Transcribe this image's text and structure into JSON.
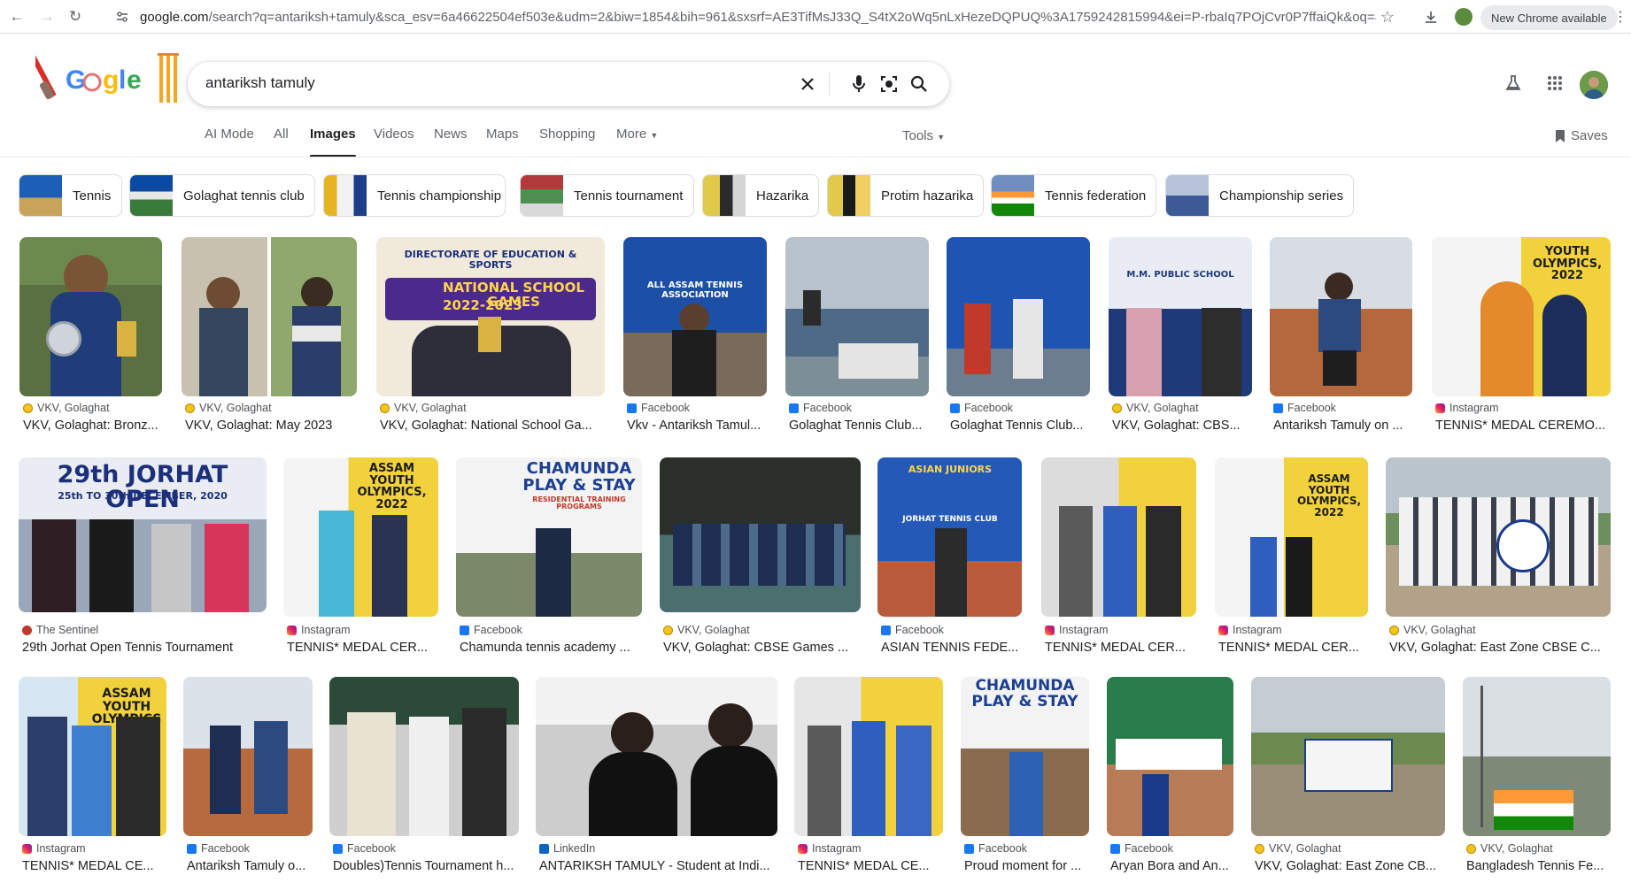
{
  "browser": {
    "url_host": "google.com",
    "url_path": "/search?q=antariksh+tamuly&sca_esv=6a46622504ef503e&udm=2&biw=1854&bih=961&sxsrf=AE3TifMsJ33Q_S4tX2oWq5nLxHezeDQPUQ%3A1759242815994&ei=P-rbaIq7POjCvr0P7ffaiQk&oq=antarIKSH+T...",
    "new_chrome_label": "New Chrome available"
  },
  "search": {
    "query": "antariksh tamuly"
  },
  "tabs": [
    {
      "label": "AI Mode"
    },
    {
      "label": "All"
    },
    {
      "label": "Images"
    },
    {
      "label": "Videos"
    },
    {
      "label": "News"
    },
    {
      "label": "Maps"
    },
    {
      "label": "Shopping"
    },
    {
      "label": "More"
    }
  ],
  "tools_label": "Tools",
  "saves_label": "Saves",
  "chips": [
    {
      "label": "Tennis"
    },
    {
      "label": "Golaghat tennis club"
    },
    {
      "label": "Tennis championship"
    },
    {
      "label": "Tennis tournament"
    },
    {
      "label": "Hazarika"
    },
    {
      "label": "Protim hazarika"
    },
    {
      "label": "Tennis federation"
    },
    {
      "label": "Championship series"
    }
  ],
  "results": [
    {
      "source": "VKV, Golaghat",
      "title": "VKV, Golaghat: Bronz..."
    },
    {
      "source": "VKV, Golaghat",
      "title": "VKV, Golaghat: May 2023"
    },
    {
      "source": "VKV, Golaghat",
      "title": "VKV, Golaghat: National School Ga..."
    },
    {
      "source": "Facebook",
      "title": "Vkv - Antariksh Tamul..."
    },
    {
      "source": "Facebook",
      "title": "Golaghat Tennis Club..."
    },
    {
      "source": "Facebook",
      "title": "Golaghat Tennis Club..."
    },
    {
      "source": "VKV, Golaghat",
      "title": "VKV, Golaghat: CBS..."
    },
    {
      "source": "Facebook",
      "title": "Antariksh Tamuly on ..."
    },
    {
      "source": "Instagram",
      "title": "TENNIS* MEDAL CEREMO..."
    },
    {
      "source": "The Sentinel",
      "title": "29th Jorhat Open Tennis Tournament"
    },
    {
      "source": "Instagram",
      "title": "TENNIS* MEDAL CER..."
    },
    {
      "source": "Facebook",
      "title": "Chamunda tennis academy ..."
    },
    {
      "source": "VKV, Golaghat",
      "title": "VKV, Golaghat: CBSE Games ..."
    },
    {
      "source": "Facebook",
      "title": "ASIAN TENNIS FEDE..."
    },
    {
      "source": "Instagram",
      "title": "TENNIS* MEDAL CER..."
    },
    {
      "source": "Instagram",
      "title": "TENNIS* MEDAL CER..."
    },
    {
      "source": "VKV, Golaghat",
      "title": "VKV, Golaghat: East Zone CBSE C..."
    },
    {
      "source": "Instagram",
      "title": "TENNIS* MEDAL CE..."
    },
    {
      "source": "Facebook",
      "title": "Antariksh Tamuly o..."
    },
    {
      "source": "Facebook",
      "title": "Doubles)Tennis Tournament h..."
    },
    {
      "source": "LinkedIn",
      "title": "ANTARIKSH TAMULY - Student at Indi..."
    },
    {
      "source": "Instagram",
      "title": "TENNIS* MEDAL CE..."
    },
    {
      "source": "Facebook",
      "title": "Proud moment for ..."
    },
    {
      "source": "Facebook",
      "title": "Aryan Bora and An..."
    },
    {
      "source": "VKV, Golaghat",
      "title": "VKV, Golaghat: East Zone CB..."
    },
    {
      "source": "VKV, Golaghat",
      "title": "Bangladesh Tennis Fe..."
    }
  ],
  "image_text": {
    "r2": "DIRECTORATE OF EDUCATION & SPORTS",
    "r2b": "NATIONAL SCHOOL GAMES",
    "r2c": "2022-2023",
    "r9": "YOUTH OLYMPICS, 2022",
    "r10": "29th JORHAT OPEN",
    "r10b": "25th TO 30th DECEMBER, 2020",
    "r11": "ASSAM YOUTH OLYMPICS, 2022",
    "r12": "CHAMUNDA PLAY & STAY",
    "r12b": "RESIDENTIAL TRAINING PROGRAMS",
    "r14": "ASIAN JUNIORS",
    "r14b": "JORHAT TENNIS CLUB",
    "r16": "ASSAM YOUTH OLYMPICS, 2022",
    "r18": "ASSAM YOUTH OLYMPICS",
    "r23": "CHAMUNDA PLAY & STAY",
    "r3": "ALL ASSAM TENNIS ASSOCIATION",
    "r7": "M.M. PUBLIC SCHOOL"
  },
  "colors": {
    "accent": "#1a73e8",
    "text": "#202124",
    "muted": "#5f6368",
    "facebook": "#1877f2",
    "linkedin": "#0a66c2"
  }
}
